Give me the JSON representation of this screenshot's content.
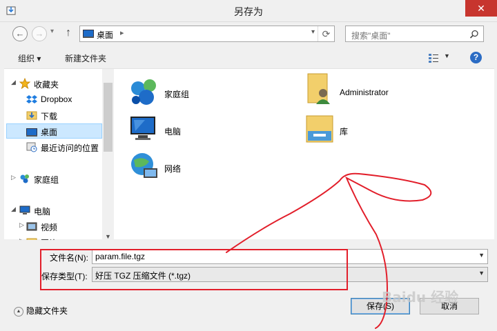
{
  "window": {
    "title": "另存为",
    "close_label": "✕"
  },
  "navigation": {
    "back_label": "←",
    "forward_label": "→",
    "up_label": "↑",
    "address": "桌面",
    "search_placeholder": "搜索\"桌面\""
  },
  "toolbar": {
    "organize_label": "组织 ▾",
    "new_folder_label": "新建文件夹"
  },
  "sidebar": {
    "items": [
      {
        "label": "收藏夹",
        "icon": "star-icon"
      },
      {
        "label": "Dropbox",
        "icon": "dropbox-icon"
      },
      {
        "label": "下载",
        "icon": "download-folder-icon"
      },
      {
        "label": "桌面",
        "icon": "desktop-icon"
      },
      {
        "label": "最近访问的位置",
        "icon": "recent-places-icon"
      },
      {
        "label": "家庭组",
        "icon": "homegroup-icon"
      },
      {
        "label": "电脑",
        "icon": "computer-icon"
      },
      {
        "label": "视频",
        "icon": "video-folder-icon"
      },
      {
        "label": "图片",
        "icon": "picture-folder-icon"
      }
    ]
  },
  "files": [
    {
      "label": "家庭组",
      "icon": "homegroup-icon"
    },
    {
      "label": "Administrator",
      "icon": "user-folder-icon"
    },
    {
      "label": "电脑",
      "icon": "computer-icon"
    },
    {
      "label": "库",
      "icon": "library-icon"
    },
    {
      "label": "网络",
      "icon": "network-icon"
    }
  ],
  "form": {
    "filename_label": "文件名(N):",
    "filename_value": "param.file.tgz",
    "filetype_label": "保存类型(T):",
    "filetype_value": "好压 TGZ 压缩文件 (*.tgz)"
  },
  "footer": {
    "hide_folders_label": "隐藏文件夹",
    "save_label": "保存(S)",
    "cancel_label": "取消"
  },
  "watermark": "Baidu 经验",
  "colors": {
    "annotation": "#e21e2a",
    "selection": "#cce8ff",
    "close": "#c7352e"
  }
}
